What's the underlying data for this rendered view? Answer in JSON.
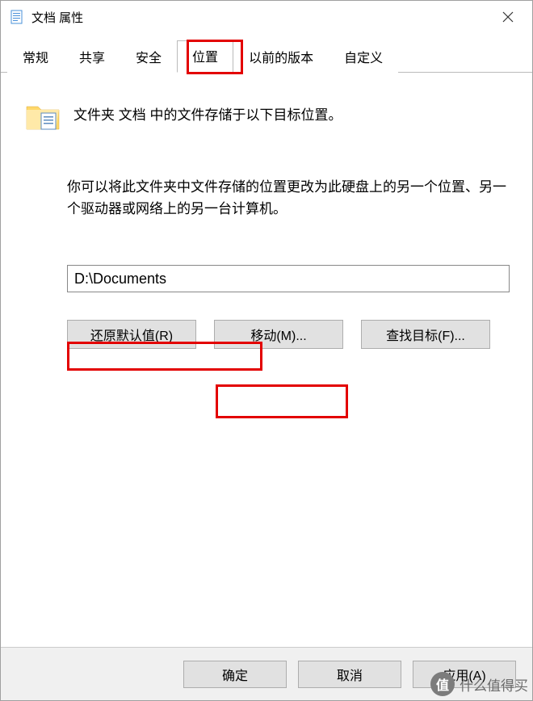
{
  "window": {
    "title": "文档 属性"
  },
  "tabs": {
    "items": [
      {
        "label": "常规"
      },
      {
        "label": "共享"
      },
      {
        "label": "安全"
      },
      {
        "label": "位置"
      },
      {
        "label": "以前的版本"
      },
      {
        "label": "自定义"
      }
    ],
    "activeIndex": 3
  },
  "content": {
    "heading": "文件夹 文档 中的文件存储于以下目标位置。",
    "description": "你可以将此文件夹中文件存储的位置更改为此硬盘上的另一个位置、另一个驱动器或网络上的另一台计算机。",
    "path_value": "D:\\Documents",
    "buttons": {
      "restore": "还原默认值(R)",
      "move": "移动(M)...",
      "find": "查找目标(F)..."
    }
  },
  "footer": {
    "ok": "确定",
    "cancel": "取消",
    "apply": "应用(A)"
  },
  "watermark": {
    "badge": "值",
    "text": "什么值得买"
  }
}
